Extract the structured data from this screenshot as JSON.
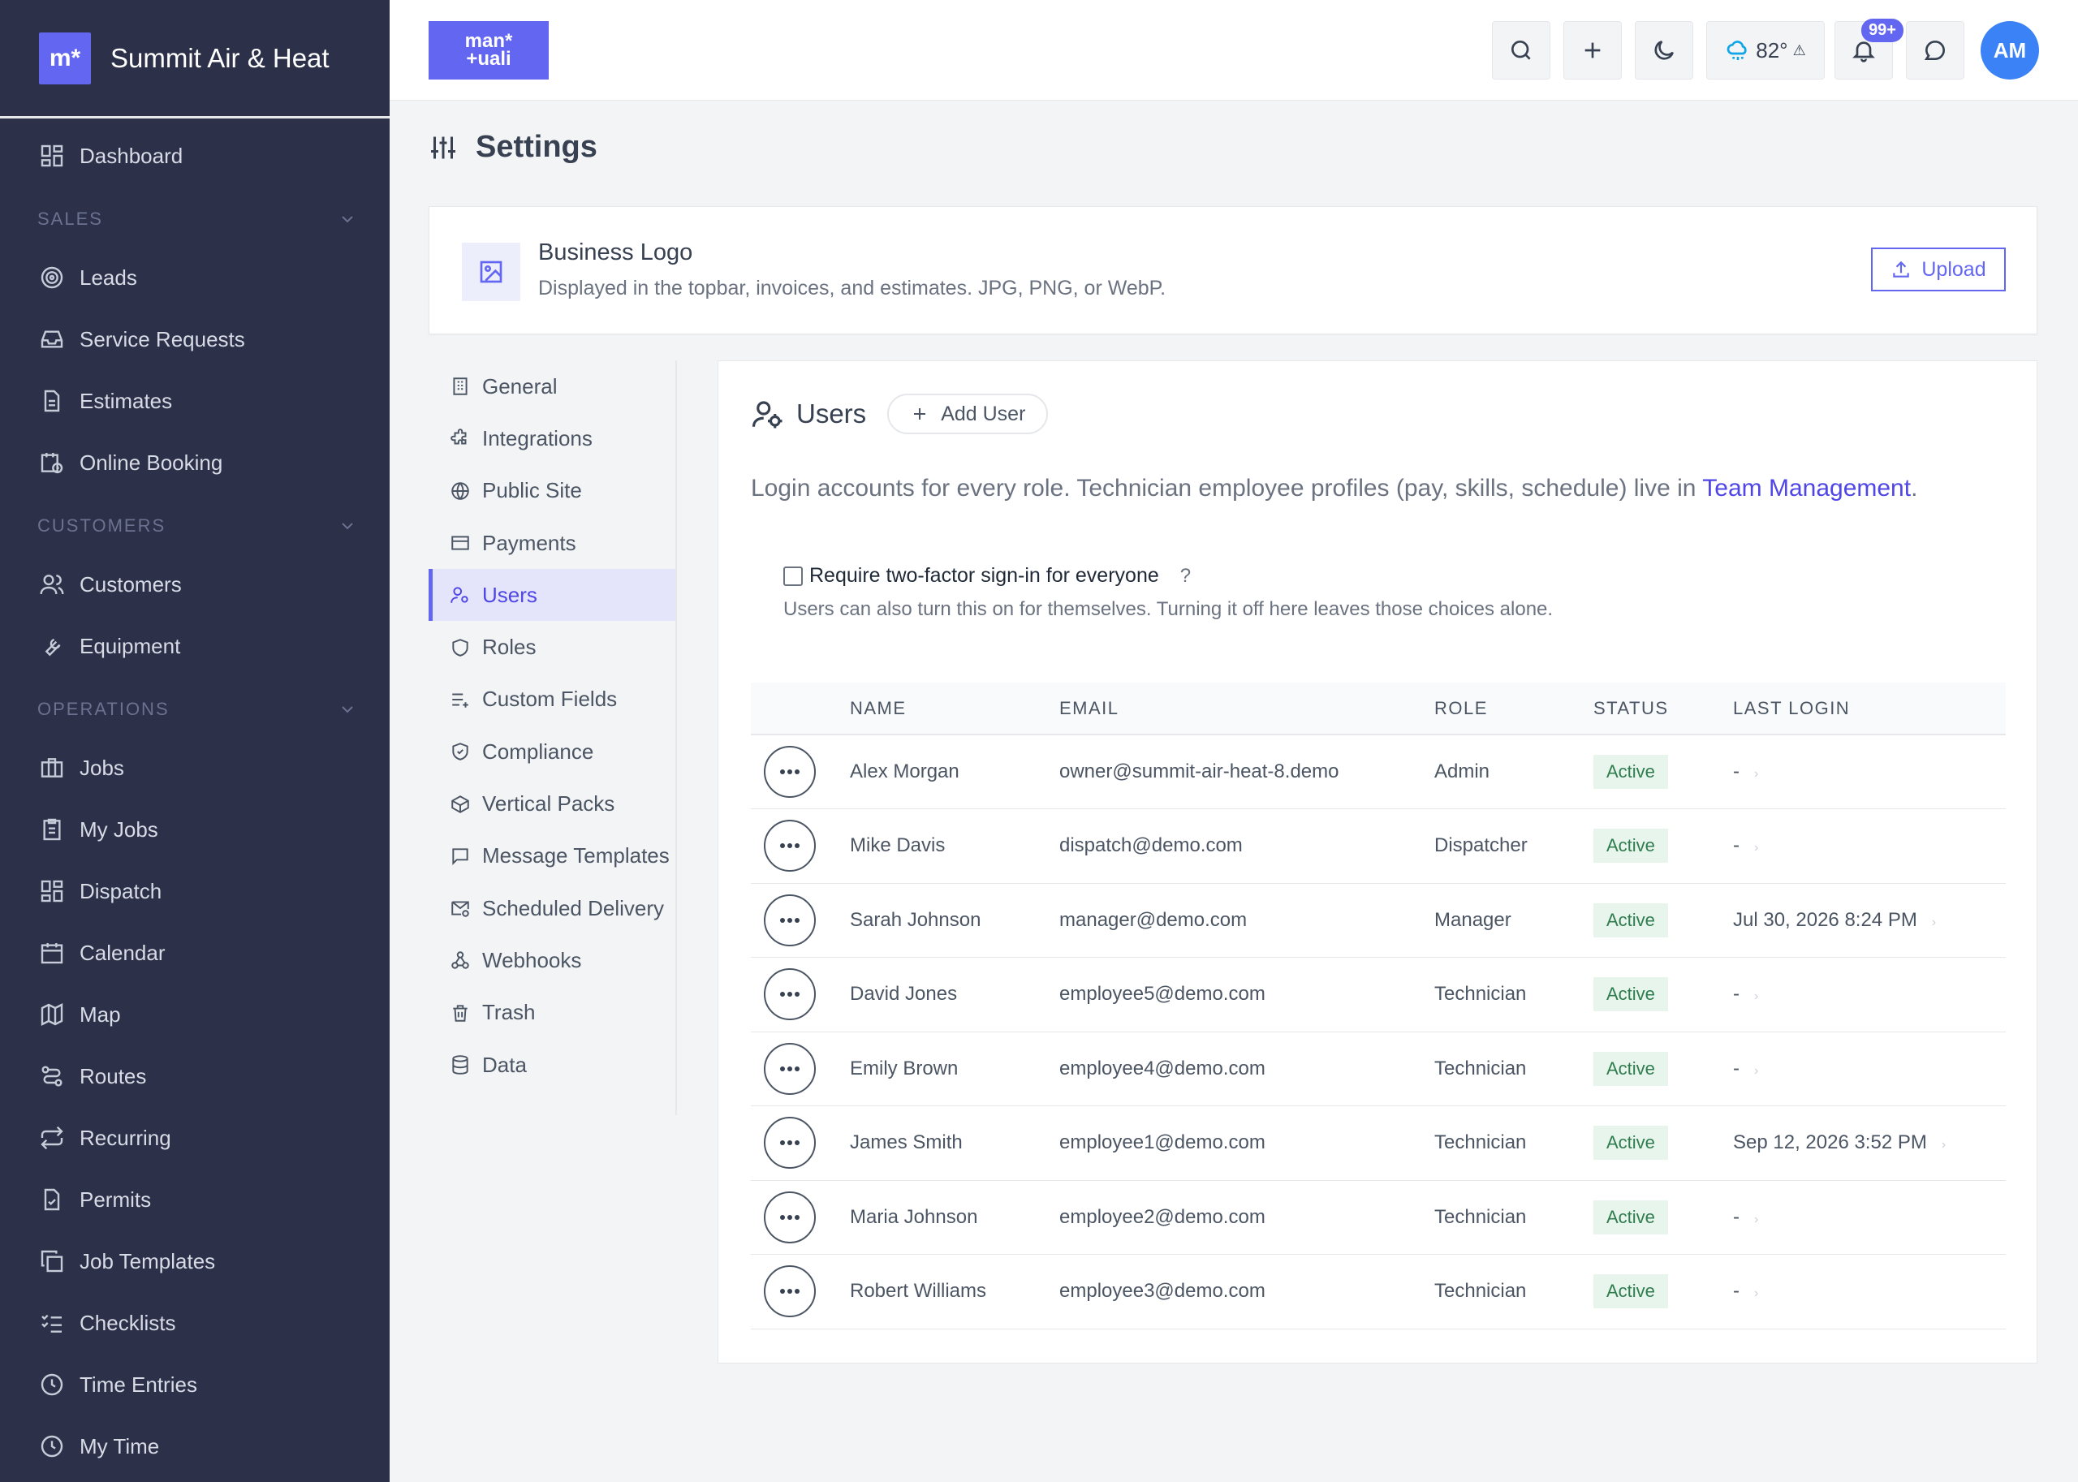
{
  "brand": {
    "logo_text": "m*",
    "name": "Summit Air & Heat"
  },
  "sidebar": {
    "dashboard": "Dashboard",
    "sections": [
      {
        "title": "SALES",
        "items": [
          "Leads",
          "Service Requests",
          "Estimates",
          "Online Booking"
        ]
      },
      {
        "title": "CUSTOMERS",
        "items": [
          "Customers",
          "Equipment"
        ]
      },
      {
        "title": "OPERATIONS",
        "items": [
          "Jobs",
          "My Jobs",
          "Dispatch",
          "Calendar",
          "Map",
          "Routes",
          "Recurring",
          "Permits",
          "Job Templates",
          "Checklists",
          "Time Entries",
          "My Time"
        ]
      }
    ]
  },
  "topbar": {
    "logo_text_top": "man*",
    "logo_text_bottom": "+uali",
    "weather_temp": "82°",
    "weather_alert": "⚠",
    "notifications_badge": "99+",
    "avatar_initials": "AM"
  },
  "page": {
    "title": "Settings"
  },
  "business_logo": {
    "title": "Business Logo",
    "description": "Displayed in the topbar, invoices, and estimates. JPG, PNG, or WebP.",
    "upload_label": "Upload"
  },
  "settings_nav": {
    "items": [
      "General",
      "Integrations",
      "Public Site",
      "Payments",
      "Users",
      "Roles",
      "Custom Fields",
      "Compliance",
      "Vertical Packs",
      "Message Templates",
      "Scheduled Delivery",
      "Webhooks",
      "Trash",
      "Data"
    ],
    "active": "Users"
  },
  "users_panel": {
    "title": "Users",
    "add_user_label": "Add User",
    "description_prefix": "Login accounts for every role. Technician employee profiles (pay, skills, schedule) live in ",
    "description_link": "Team Management",
    "description_suffix": ".",
    "tfa_label": "Require two-factor sign-in for everyone",
    "tfa_help": "?",
    "tfa_description": "Users can also turn this on for themselves. Turning it off here leaves those choices alone.",
    "columns": [
      "NAME",
      "EMAIL",
      "ROLE",
      "STATUS",
      "LAST LOGIN"
    ],
    "rows": [
      {
        "name": "Alex Morgan",
        "email": "owner@summit-air-heat-8.demo",
        "role": "Admin",
        "status": "Active",
        "last_login": "-"
      },
      {
        "name": "Mike Davis",
        "email": "dispatch@demo.com",
        "role": "Dispatcher",
        "status": "Active",
        "last_login": "-"
      },
      {
        "name": "Sarah Johnson",
        "email": "manager@demo.com",
        "role": "Manager",
        "status": "Active",
        "last_login": "Jul 30, 2026 8:24 PM"
      },
      {
        "name": "David Jones",
        "email": "employee5@demo.com",
        "role": "Technician",
        "status": "Active",
        "last_login": "-"
      },
      {
        "name": "Emily Brown",
        "email": "employee4@demo.com",
        "role": "Technician",
        "status": "Active",
        "last_login": "-"
      },
      {
        "name": "James Smith",
        "email": "employee1@demo.com",
        "role": "Technician",
        "status": "Active",
        "last_login": "Sep 12, 2026 3:52 PM"
      },
      {
        "name": "Maria Johnson",
        "email": "employee2@demo.com",
        "role": "Technician",
        "status": "Active",
        "last_login": "-"
      },
      {
        "name": "Robert Williams",
        "email": "employee3@demo.com",
        "role": "Technician",
        "status": "Active",
        "last_login": "-"
      }
    ]
  },
  "colors": {
    "accent": "#6366f1",
    "sidebar_bg": "#2c3048",
    "status_active_bg": "#e8f5ec",
    "status_active_text": "#2f7d4e"
  }
}
